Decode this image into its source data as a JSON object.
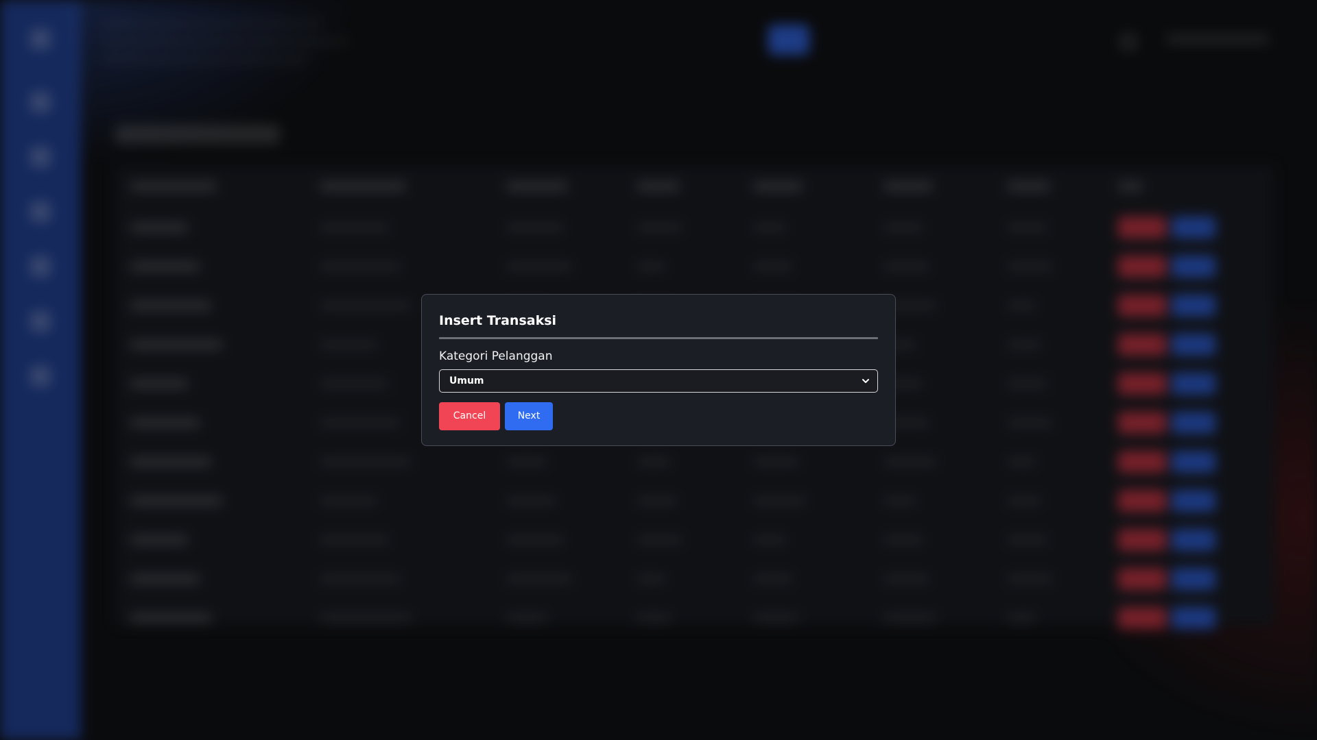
{
  "modal": {
    "title": "Insert Transaksi",
    "field_label": "Kategori Pelanggan",
    "select": {
      "value": "Umum",
      "icon": "chevron-down-icon"
    },
    "cancel_label": "Cancel",
    "next_label": "Next"
  },
  "colors": {
    "sidebar": "#1f3e8e",
    "cancel_button": "#f14555",
    "next_button": "#2f6cf2",
    "modal_background": "#1c1e25",
    "page_background": "#0e0f12"
  }
}
